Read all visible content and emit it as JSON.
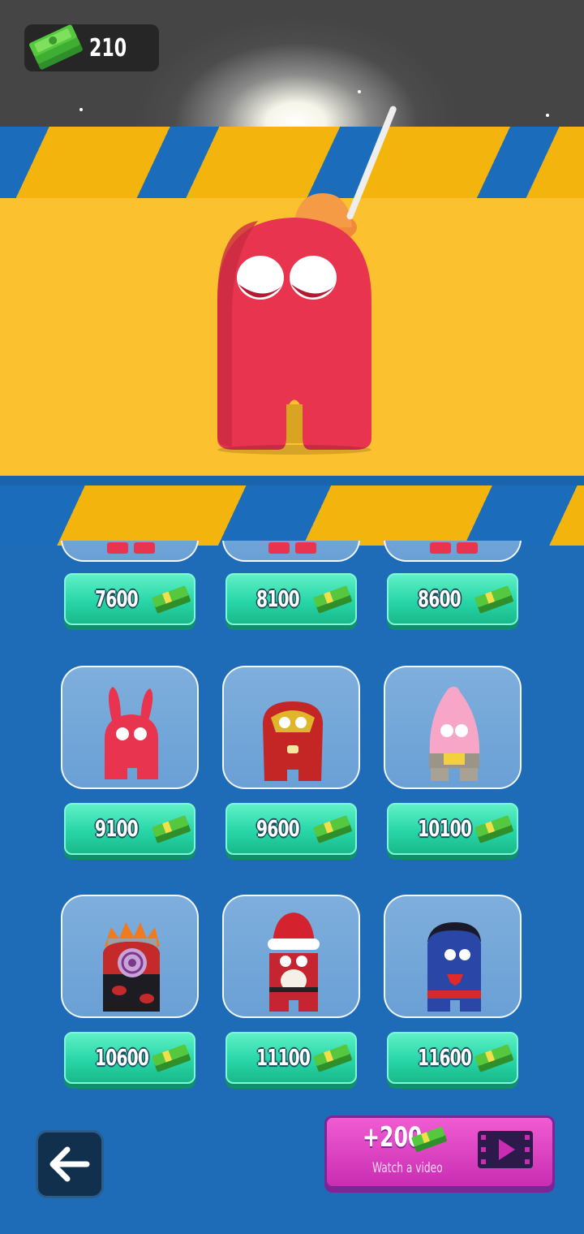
{
  "currency": {
    "amount": "210",
    "icon": "cash-stack-icon"
  },
  "preview": {
    "character": "red-crewmate-with-plunger-hat"
  },
  "shop": {
    "partial_prices": [
      "7600",
      "8100",
      "8600"
    ],
    "rows": [
      [
        {
          "price": "9100",
          "skin": "bunny-ears-red"
        },
        {
          "price": "9600",
          "skin": "iron-armor-red"
        },
        {
          "price": "10100",
          "skin": "pink-star-buddy"
        }
      ],
      [
        {
          "price": "10600",
          "skin": "ninja-cloak-red-clouds"
        },
        {
          "price": "11100",
          "skin": "santa-suit"
        },
        {
          "price": "11600",
          "skin": "super-hero-blue"
        }
      ]
    ]
  },
  "reward": {
    "amount": "+200",
    "label": "Watch a video",
    "icon": "video-play-icon"
  },
  "nav": {
    "back_icon": "back-arrow-icon"
  },
  "colors": {
    "price_button": "#28d6a8",
    "reward_button": "#d93dbf",
    "panel": "#1e6bb8",
    "stage": "#fbc12f"
  }
}
